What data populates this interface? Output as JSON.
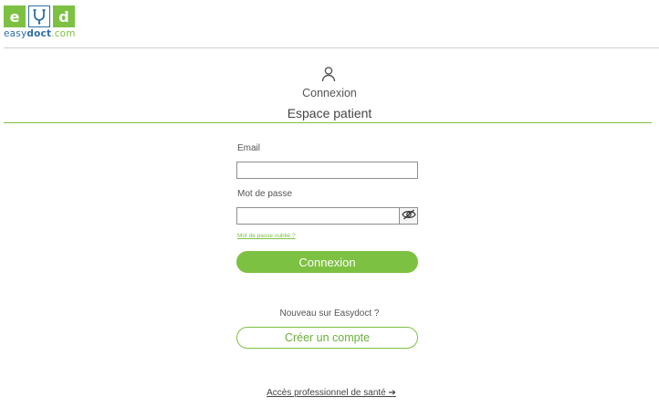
{
  "logo": {
    "tile1": "e",
    "tile3": "d",
    "text_part1": "easy",
    "text_part2": "doct",
    "text_part3": ".com",
    "stethoscope_icon": "stethoscope-icon"
  },
  "title": {
    "icon": "user-icon",
    "small": "Connexion",
    "main": "Espace patient"
  },
  "form": {
    "email_label": "Email",
    "email_value": "",
    "password_label": "Mot de passe",
    "password_value": "",
    "show_password_icon": "eye-slash-icon",
    "forgot_link": "Mot de passe oublié ?",
    "submit_label": "Connexion"
  },
  "signup": {
    "prompt": "Nouveau sur Easydoct ?",
    "button_label": "Créer un compte"
  },
  "footer": {
    "pro_link": "Accès professionnel de santé ➔"
  },
  "colors": {
    "accent_green": "#7dc142",
    "brand_blue": "#2f6ea8"
  }
}
